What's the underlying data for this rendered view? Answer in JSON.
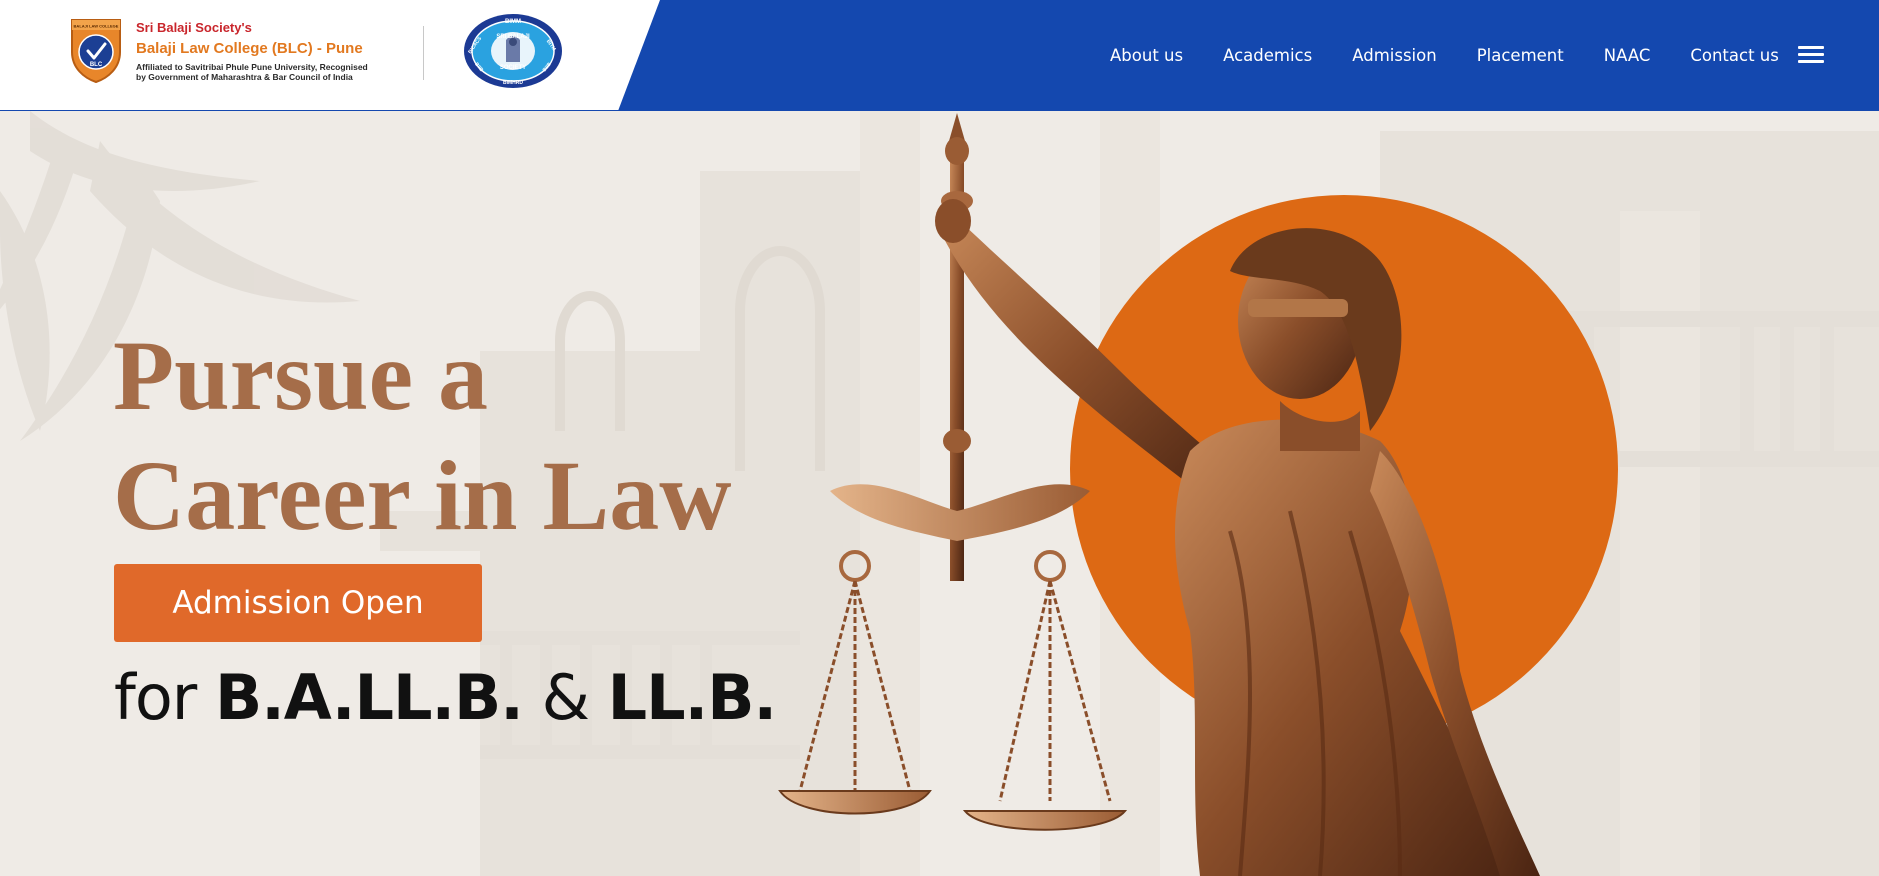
{
  "header": {
    "brand": {
      "society": "Sri Balaji Society's",
      "college": "Balaji Law College (BLC) - Pune",
      "affiliation_line1": "Affiliated to Savitribai Phule Pune University, Recognised",
      "affiliation_line2": "by Government of Maharashtra & Bar Council of India",
      "blc_logo_top": "BALAJI LAW COLLEGE",
      "blc_logo_badge": "BLC",
      "society_logo_text": "SRI BALAJI SOCIETY",
      "society_logo_ring_left": "BICACS",
      "society_logo_ring_top": "BIMM",
      "society_logo_ring_right": "BITM",
      "society_logo_ring_bl": "BIIB",
      "society_logo_ring_br": "BIIB",
      "society_logo_ring_bottom": "BIMHRD"
    },
    "nav": [
      {
        "label": "About us"
      },
      {
        "label": "Academics"
      },
      {
        "label": "Admission"
      },
      {
        "label": "Placement"
      },
      {
        "label": "NAAC"
      },
      {
        "label": "Contact us"
      }
    ],
    "menu_icon": "hamburger-icon"
  },
  "hero": {
    "headline_line1": "Pursue a",
    "headline_line2": "Career in Law",
    "button_label": "Admission Open",
    "programs_prefix": "for",
    "program_1": "B.A.LL.B.",
    "programs_join": "&",
    "program_2": "LL.B."
  },
  "colors": {
    "nav_blue": "#1448af",
    "headline_brown": "#a56d49",
    "button_orange": "#e0692a",
    "circle_orange": "#dd6914",
    "hero_bg": "#efebe6"
  }
}
